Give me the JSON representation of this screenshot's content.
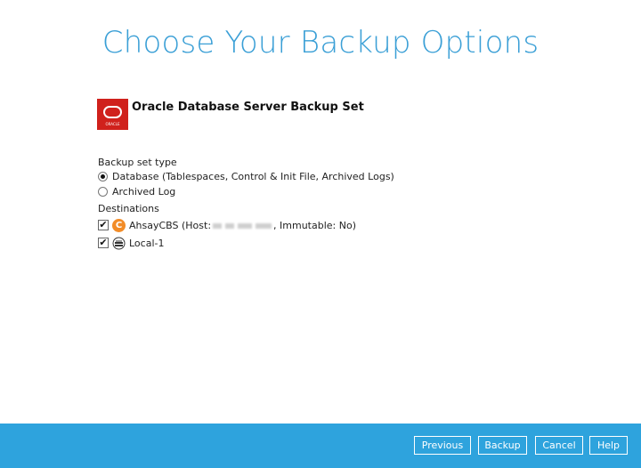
{
  "title": "Choose Your Backup Options",
  "backup_set": {
    "logo_text": "ORACLE",
    "name": "Oracle Database Server Backup Set"
  },
  "backup_set_type": {
    "label": "Backup set type",
    "options": [
      {
        "label": "Database (Tablespaces, Control & Init File, Archived Logs)",
        "selected": true
      },
      {
        "label": "Archived Log",
        "selected": false
      }
    ]
  },
  "destinations": {
    "label": "Destinations",
    "items": [
      {
        "icon": "ahsay-cbs-icon",
        "prefix": "AhsayCBS (Host: ",
        "suffix": ", Immutable: No)",
        "checked": true
      },
      {
        "icon": "local-storage-icon",
        "label": "Local-1",
        "checked": true
      }
    ]
  },
  "footer": {
    "previous_label": "Previous",
    "backup_label": "Backup",
    "cancel_label": "Cancel",
    "help_label": "Help"
  },
  "colors": {
    "accent": "#3a9fd6",
    "footer_bg": "#2ea3dd",
    "oracle_red": "#d0211c",
    "cbs_orange": "#f28c28"
  }
}
